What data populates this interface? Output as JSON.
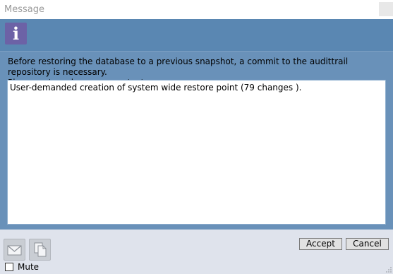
{
  "window": {
    "title": "Message"
  },
  "header": {
    "icon": "info-icon",
    "icon_glyph": "i",
    "icon_color": "#6c62a6",
    "band_color": "#5a87b2"
  },
  "message": {
    "text": "Before restoring the database to a previous snapshot, a commit to the audittrail repository is necessary.\nPlease enter a log message text:",
    "log_value": "User-demanded creation of system wide restore point (79 changes )."
  },
  "footer": {
    "mail_icon": "mail-icon",
    "copy_icon": "copy-icon",
    "mute_label": "Mute",
    "mute_checked": false,
    "accept_label": "Accept",
    "cancel_label": "Cancel"
  }
}
